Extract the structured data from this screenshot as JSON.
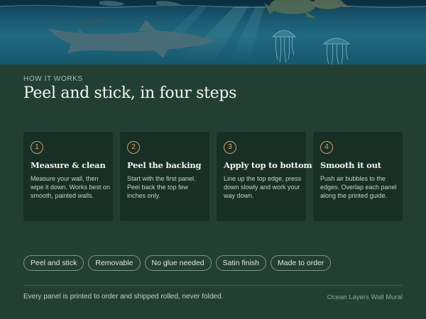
{
  "hero": {
    "image_name": "ocean-scene-shark-turtles-jellyfish"
  },
  "section": {
    "eyebrow": "HOW IT WORKS",
    "title": "Peel and stick, in four steps"
  },
  "steps": [
    {
      "number": "1",
      "title": "Measure & clean",
      "body": "Measure your wall, then wipe it down. Works best on smooth, painted walls."
    },
    {
      "number": "2",
      "title": "Peel the backing",
      "body": "Start with the first panel. Peel back the top few inches only."
    },
    {
      "number": "3",
      "title": "Apply top to bottom",
      "body": "Line up the top edge, press down slowly and work your way down."
    },
    {
      "number": "4",
      "title": "Smooth it out",
      "body": "Push air bubbles to the edges. Overlap each panel along the printed guide."
    }
  ],
  "tags": [
    "Peel and stick",
    "Removable",
    "No glue needed",
    "Satin finish",
    "Made to order"
  ],
  "footer": {
    "note": "Every panel is printed to order and shipped rolled, never folded.",
    "product_name": "Ocean Layers Wall Mural"
  },
  "colors": {
    "background": "#233f34",
    "card": "#182f26",
    "accent": "#d99b62"
  }
}
